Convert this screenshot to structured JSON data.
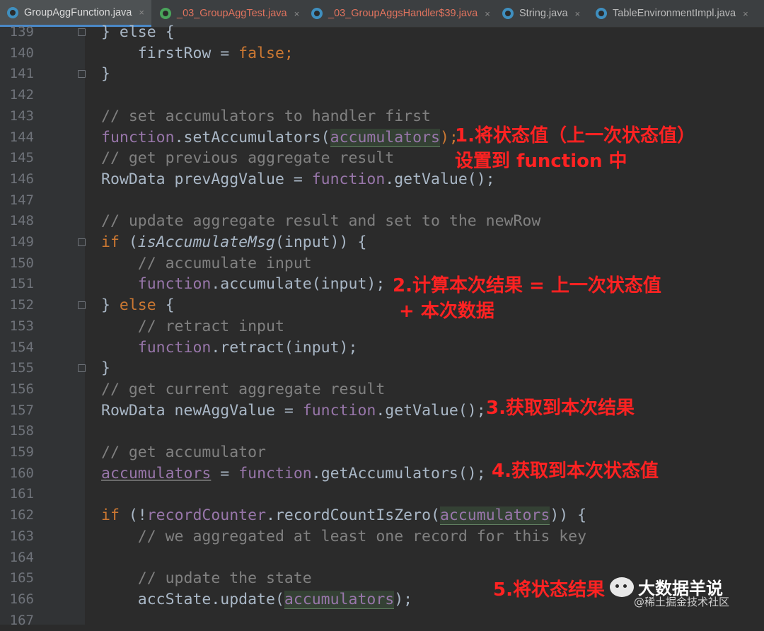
{
  "tabs": [
    {
      "label": "GroupAggFunction.java",
      "close": "×",
      "active": true
    },
    {
      "label": "_03_GroupAggTest.java",
      "close": "×",
      "active": false
    },
    {
      "label": "_03_GroupAggsHandler$39.java",
      "close": "×",
      "active": false
    },
    {
      "label": "String.java",
      "close": "×",
      "active": false
    },
    {
      "label": "TableEnvironmentImpl.java",
      "close": "×",
      "active": false
    }
  ],
  "lines": [
    {
      "n": "139"
    },
    {
      "n": "140"
    },
    {
      "n": "141"
    },
    {
      "n": "142"
    },
    {
      "n": "143"
    },
    {
      "n": "144"
    },
    {
      "n": "145"
    },
    {
      "n": "146"
    },
    {
      "n": "147"
    },
    {
      "n": "148"
    },
    {
      "n": "149"
    },
    {
      "n": "150"
    },
    {
      "n": "151"
    },
    {
      "n": "152"
    },
    {
      "n": "153"
    },
    {
      "n": "154"
    },
    {
      "n": "155"
    },
    {
      "n": "156"
    },
    {
      "n": "157"
    },
    {
      "n": "158"
    },
    {
      "n": "159"
    },
    {
      "n": "160"
    },
    {
      "n": "161"
    },
    {
      "n": "162"
    },
    {
      "n": "163"
    },
    {
      "n": "164"
    },
    {
      "n": "165"
    },
    {
      "n": "166"
    },
    {
      "n": "167"
    }
  ],
  "code": {
    "l139": "} else {",
    "l140_a": "    firstRow = ",
    "l140_b": "false",
    "l140_c": ";",
    "l141": "}",
    "l143": "// set accumulators to handler first",
    "l144_a": "function",
    "l144_b": ".setAccumulators(",
    "l144_c": "accumulators",
    "l144_d": ");",
    "l145": "// get previous aggregate result",
    "l146_a": "RowData prevAggValue = ",
    "l146_b": "function",
    "l146_c": ".getValue();",
    "l148": "// update aggregate result and set to the newRow",
    "l149_a": "if",
    "l149_b": " (",
    "l149_c": "isAccumulateMsg",
    "l149_d": "(input)) {",
    "l150": "    // accumulate input",
    "l151_a": "    ",
    "l151_b": "function",
    "l151_c": ".accumulate(input);",
    "l152_a": "} ",
    "l152_b": "else",
    "l152_c": " {",
    "l153": "    // retract input",
    "l154_a": "    ",
    "l154_b": "function",
    "l154_c": ".retract(input);",
    "l155": "}",
    "l156": "// get current aggregate result",
    "l157_a": "RowData newAggValue = ",
    "l157_b": "function",
    "l157_c": ".getValue();",
    "l159": "// get accumulator",
    "l160_a": "accumulators",
    "l160_b": " = ",
    "l160_c": "function",
    "l160_d": ".getAccumulators();",
    "l162_a": "if",
    "l162_b": " (!",
    "l162_c": "recordCounter",
    "l162_d": ".recordCountIsZero(",
    "l162_e": "accumulators",
    "l162_f": ")) {",
    "l163": "    // we aggregated at least one record for this key",
    "l165": "    // update the state",
    "l166_a": "    accState.update(",
    "l166_b": "accumulators",
    "l166_c": ");"
  },
  "notes": {
    "n1": "1.将状态值（上一次状态值）\n设置到 function 中",
    "n2": "2.计算本次结果 = 上一次状态值\n + 本次数据",
    "n3": "3.获取到本次结果",
    "n4": "4.获取到本次状态值",
    "n5": "5.将状态结果"
  },
  "watermark": {
    "title": "大数据羊说",
    "sub": "@稀土掘金技术社区"
  }
}
